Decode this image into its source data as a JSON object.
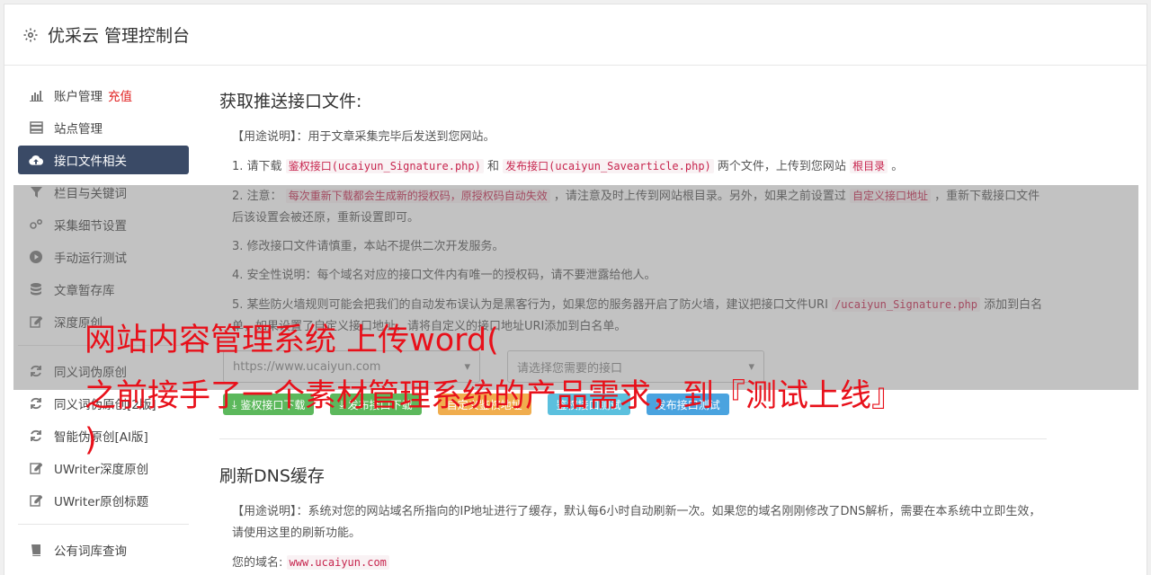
{
  "header": {
    "title": "优采云 管理控制台",
    "icon": "gear-icon"
  },
  "sidebar": {
    "items": [
      {
        "label": "账户管理",
        "extra": "充值",
        "icon": "bar-chart-icon"
      },
      {
        "label": "站点管理",
        "icon": "server-icon"
      },
      {
        "label": "接口文件相关",
        "icon": "cloud-upload-icon",
        "active": true
      },
      {
        "label": "栏目与关键词",
        "icon": "filter-icon"
      },
      {
        "label": "采集细节设置",
        "icon": "gears-icon"
      },
      {
        "label": "手动运行测试",
        "icon": "play-circle-icon"
      },
      {
        "label": "文章暂存库",
        "icon": "database-icon"
      },
      {
        "label": "深度原创",
        "icon": "edit-icon"
      },
      {
        "label": "同义词伪原创",
        "icon": "refresh-icon"
      },
      {
        "label": "同义词伪原创[2版]",
        "icon": "refresh-icon"
      },
      {
        "label": "智能伪原创[AI版]",
        "icon": "refresh-icon"
      },
      {
        "label": "UWriter深度原创",
        "icon": "edit-icon"
      },
      {
        "label": "UWriter原创标题",
        "icon": "edit-icon"
      },
      {
        "label": "公有词库查询",
        "icon": "book-icon"
      }
    ]
  },
  "section1": {
    "title": "获取推送接口文件:",
    "usage": "【用途说明】：用于文章采集完毕后发送到您网站。",
    "step1": {
      "prefix": "1. 请下载",
      "code1": "鉴权接口(ucaiyun_Signature.php)",
      "mid": "和",
      "code2": "发布接口(ucaiyun_Savearticle.php)",
      "mid2": "两个文件，上传到您网站",
      "code3": "根目录",
      "suffix": "。"
    },
    "step2": {
      "prefix": "2. 注意：",
      "code1": "每次重新下载都会生成新的授权码，原授权码自动失效",
      "mid": "，请注意及时上传到网站根目录。另外，如果之前设置过",
      "code2": "自定义接口地址",
      "suffix": "，重新下载接口文件后该设置会被还原，重新设置即可。"
    },
    "step3": "3. 修改接口文件请慎重，本站不提供二次开发服务。",
    "step4": "4. 安全性说明：每个域名对应的接口文件内有唯一的授权码，请不要泄露给他人。",
    "step5": {
      "prefix": "5. 某些防火墙规则可能会把我们的自动发布误认为是黑客行为，如果您的服务器开启了防火墙，建议把接口文件URI",
      "code1": "/ucaiyun_Signature.php",
      "suffix": "添加到白名单，如果设置了自定义接口地址，请将自定义的接口地址URI添加到白名单。"
    },
    "select_site": "https://www.ucaiyun.com",
    "select_iface": "请选择您需要的接口",
    "buttons": {
      "auth_download": "鉴权接口下载",
      "publish_download": "发布接口下载",
      "custom_address": "自定义鉴权地址",
      "auth_test": "鉴权接口测试",
      "publish_test": "发布接口测试"
    }
  },
  "section2": {
    "title": "刷新DNS缓存",
    "usage": "【用途说明】：系统对您的网站域名所指向的IP地址进行了缓存，默认每6小时自动刷新一次。如果您的域名刚刚修改了DNS解析，需要在本系统中立即生效，请使用这里的刷新功能。",
    "domain_label": "您的域名:",
    "domain_value": "www.ucaiyun.com"
  },
  "overlay": {
    "line1": "网站内容管理系统 上传word(",
    "line2": "之前接手了一个素材管理系统的产品需求，到『测试上线』",
    "line3": ")"
  }
}
